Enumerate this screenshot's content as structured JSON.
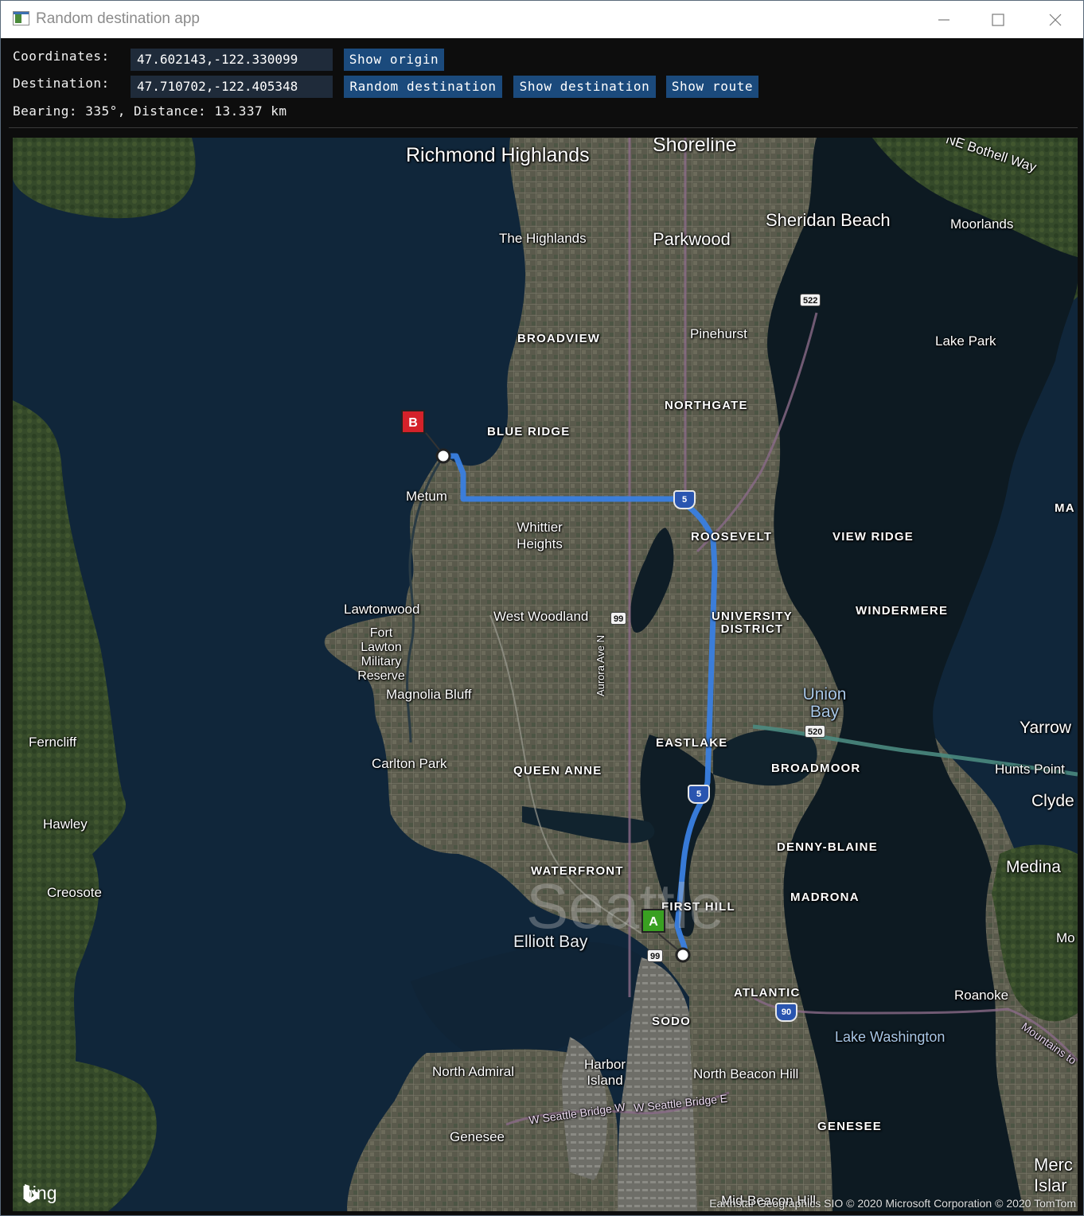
{
  "window": {
    "title": "Random destination app"
  },
  "controls": {
    "coordinates_label": "Coordinates:",
    "coordinates_value": "47.602143,-122.330099",
    "show_origin": "Show origin",
    "destination_label": "Destination:",
    "destination_value": "47.710702,-122.405348",
    "random_destination": "Random destination",
    "show_destination": "Show destination",
    "show_route": "Show route",
    "bearing_text": "Bearing: 335°, Distance: 13.337 km"
  },
  "map": {
    "places": {
      "richmond_highlands": "Richmond Highlands",
      "shoreline": "Shoreline",
      "ne_bothell_way": "NE Bothell Way",
      "sheridan_beach": "Sheridan Beach",
      "moorlands": "Moorlands",
      "the_highlands": "The Highlands",
      "parkwood": "Parkwood",
      "broadview": "BROADVIEW",
      "pinehurst": "Pinehurst",
      "lake_park": "Lake Park",
      "northgate": "NORTHGATE",
      "blue_ridge": "BLUE RIDGE",
      "metum": "Metum",
      "whittier_heights": "Whittier Heights",
      "roosevelt": "ROOSEVELT",
      "view_ridge": "VIEW RIDGE",
      "ma": "MA",
      "lawtonwood": "Lawtonwood",
      "west_woodland": "West Woodland",
      "university_district": "UNIVERSITY DISTRICT",
      "windermere": "WINDERMERE",
      "fort_lawton": "Fort Lawton Military Reserve",
      "aurora_ave": "Aurora Ave N",
      "magnolia_bluff": "Magnolia Bluff",
      "union_bay": "Union Bay",
      "yarrow": "Yarrow",
      "ferncliff": "Ferncliff",
      "eastlake": "EASTLAKE",
      "broadmoor": "BROADMOOR",
      "hunts_point": "Hunts Point",
      "carlton_park": "Carlton Park",
      "queen_anne": "QUEEN ANNE",
      "clyde": "Clyde",
      "hawley": "Hawley",
      "denny_blaine": "DENNY-BLAINE",
      "medina": "Medina",
      "waterfront": "WATERFRONT",
      "creosote": "Creosote",
      "first_hill": "FIRST HILL",
      "madrona": "MADRONA",
      "elliott_bay": "Elliott Bay",
      "seattle": "Seattle",
      "mo": "Mo",
      "atlantic": "ATLANTIC",
      "roanoke": "Roanoke",
      "sodo": "SODO",
      "lake_washington": "Lake Washington",
      "mountains_to": "Mountains to",
      "north_admiral": "North Admiral",
      "harbor_island": "Harbor Island",
      "north_beacon_hill": "North Beacon Hill",
      "seattle_bridge_w": "W Seattle Bridge W",
      "seattle_bridge_e": "W Seattle Bridge E",
      "genesee_left": "Genesee",
      "genesee_right": "GENESEE",
      "mercer_island": "Merc Islar",
      "beacon_hill": "Mid-Beacon Hill"
    },
    "shields": {
      "sr522": "522",
      "sr99_north": "99",
      "sr520": "520",
      "sr99_south": "99",
      "i5_north": "5",
      "i5_mid": "5",
      "i90": "90"
    },
    "pins": {
      "destination": "B",
      "origin": "A"
    },
    "logo_text": "bing",
    "attribution": "Earthstar Geographics SIO © 2020 Microsoft Corporation © 2020 TomTom",
    "route_color": "#3a7fe0"
  }
}
